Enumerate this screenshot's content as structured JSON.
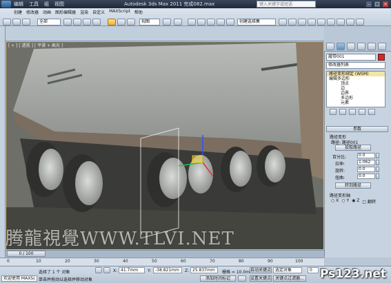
{
  "app": {
    "title": "Autodesk 3ds Max  2011     完成082.max",
    "menu": [
      "编辑",
      "工具",
      "组",
      "视图",
      "创建",
      "修改器",
      "动画",
      "图形编辑器",
      "渲染",
      "自定义",
      "MAXScript",
      "帮助"
    ],
    "help_placeholder": "键入关键字或短语"
  },
  "toolbar": {
    "selection_filter": "全部",
    "coord_system": "视图",
    "named_selection": "创建选择集"
  },
  "viewport": {
    "label": "[ + ] [ 透视 ] [ 平滑 + 高光 ]",
    "watermark": "腾龍視覺WWW.TLVI.NET",
    "accent_color": "#e8c24a"
  },
  "command_panel": {
    "object_name": "履带001",
    "object_color": "#cc2b2b",
    "modifier_list": "修改器列表",
    "stack": [
      {
        "label": "路径变形绑定 (WSM)",
        "active": true
      },
      {
        "label": "编辑多边形",
        "active": false
      },
      {
        "label": "顶点",
        "active": false,
        "sub": true
      },
      {
        "label": "边",
        "active": false,
        "sub": true
      },
      {
        "label": "边界",
        "active": false,
        "sub": true
      },
      {
        "label": "多边形",
        "active": false,
        "sub": true
      },
      {
        "label": "元素",
        "active": false,
        "sub": true
      }
    ],
    "params_rollout": "参数",
    "path_deform": "路径变形",
    "path_label": "路径: 路径001",
    "pick_path": "拾取路径",
    "percent_label": "百分比:",
    "percent_value": "0.0",
    "stretch_label": "拉伸:",
    "stretch_value": "1.062",
    "rotation_label": "旋转:",
    "rotation_value": "0.0",
    "twist_label": "扭曲:",
    "twist_value": "0.0",
    "move_to_path": "转到路径",
    "axis_rollout": "路径变形轴",
    "axes": [
      "X",
      "Y",
      "Z"
    ],
    "flip_label": "翻转"
  },
  "timeline": {
    "slider": "0 / 100",
    "ticks": [
      "0",
      "10",
      "20",
      "30",
      "40",
      "50",
      "60",
      "70",
      "80",
      "90",
      "100"
    ]
  },
  "status": {
    "selected": "选择了 1 个 对象",
    "x_label": "X:",
    "x_value": "41.7mm",
    "y_label": "Y:",
    "y_value": "-38.821mm",
    "z_label": "Z:",
    "z_value": "25.837mm",
    "grid": "栅格 = 10.0mm",
    "autokey": "自动关键点",
    "selected_obj": "选定对象",
    "set_key": "设置关键点",
    "key_filters": "关键点过滤器...",
    "prompt": "单击并拖动以选择并移动对象",
    "add_time_tag": "添加时间标记",
    "maxscript_welcome": "欢迎使用 MAXSc",
    "frame": "0",
    "site_watermark": "Ps123.net"
  }
}
